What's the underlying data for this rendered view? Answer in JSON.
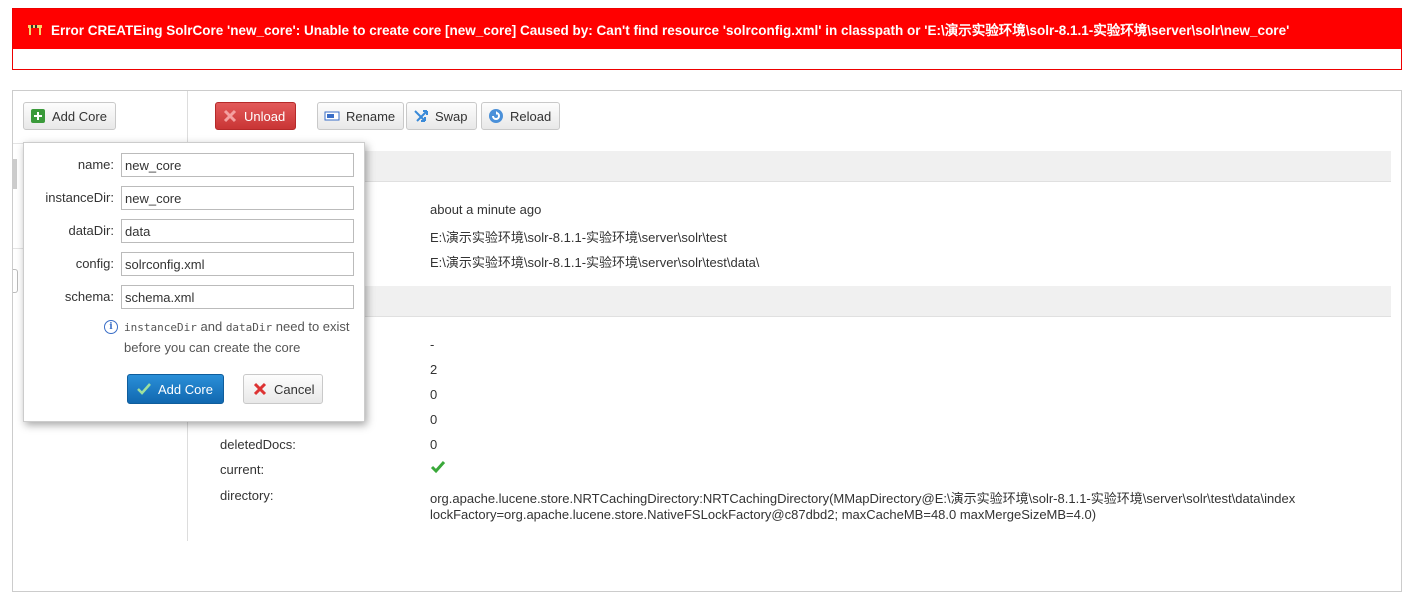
{
  "error": {
    "message": "Error CREATEing SolrCore 'new_core': Unable to create core [new_core] Caused by: Can't find resource 'solrconfig.xml' in classpath or 'E:\\演示实验环境\\solr-8.1.1-实验环境\\server\\solr\\new_core'",
    "color": "#ff0000"
  },
  "toolbar": {
    "add_core": "Add Core",
    "unload": "Unload",
    "rename": "Rename",
    "swap": "Swap",
    "reload": "Reload"
  },
  "core_info": {
    "start_value": "about a minute ago",
    "instance_value": "E:\\演示实验环境\\solr-8.1.1-实验环境\\server\\solr\\test",
    "data_value": "E:\\演示实验环境\\solr-8.1.1-实验环境\\server\\solr\\test\\data\\"
  },
  "index_info": {
    "last_modified_value": "-",
    "version_value": "2",
    "num_docs_value": "0",
    "max_doc_value": "0",
    "deleted_docs_label": "deletedDocs:",
    "deleted_docs_value": "0",
    "current_label": "current:",
    "current_icon": "check-icon",
    "directory_label": "directory:",
    "directory_line1": "org.apache.lucene.store.NRTCachingDirectory:NRTCachingDirectory(MMapDirectory@E:\\演示实验环境\\solr-8.1.1-实验环境\\server\\solr\\test\\data\\index",
    "directory_line2": "lockFactory=org.apache.lucene.store.NativeFSLockFactory@c87dbd2; maxCacheMB=48.0 maxMergeSizeMB=4.0)"
  },
  "add_core_form": {
    "name_label": "name:",
    "name_value": "new_core",
    "instance_dir_label": "instanceDir:",
    "instance_dir_value": "new_core",
    "data_dir_label": "dataDir:",
    "data_dir_value": "data",
    "config_label": "config:",
    "config_value": "solrconfig.xml",
    "schema_label": "schema:",
    "schema_value": "schema.xml",
    "hint_code1": "instanceDir",
    "hint_and": "and",
    "hint_code2": "dataDir",
    "hint_rest": "need to exist before you can create the core",
    "submit_label": "Add Core",
    "cancel_label": "Cancel"
  }
}
